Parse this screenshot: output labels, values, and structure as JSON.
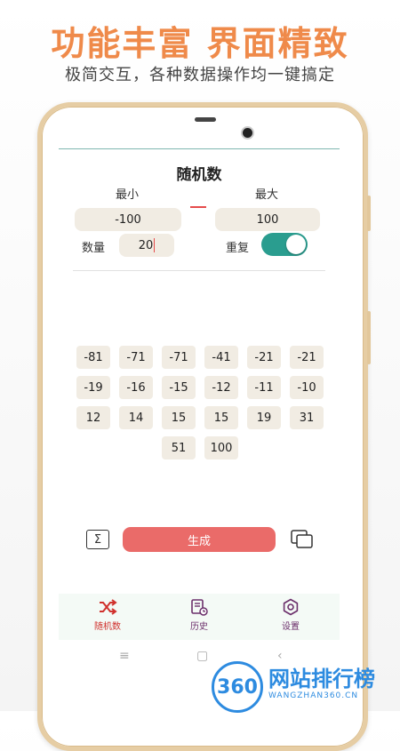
{
  "banner": {
    "headline": "功能丰富 界面精致",
    "subline": "极简交互，各种数据操作均一键搞定"
  },
  "app": {
    "title": "随机数",
    "min_label": "最小",
    "max_label": "最大",
    "min_value": "-100",
    "max_value": "100",
    "count_label": "数量",
    "count_value": "20",
    "repeat_label": "重复",
    "repeat_on": true,
    "results": [
      "-81",
      "-71",
      "-71",
      "-41",
      "-21",
      "-21",
      "-19",
      "-16",
      "-15",
      "-12",
      "-11",
      "-10",
      "12",
      "14",
      "15",
      "15",
      "19",
      "31",
      "51",
      "100"
    ],
    "sum_icon": "Σ",
    "generate_label": "生成",
    "tabs": [
      {
        "label": "随机数",
        "icon": "shuffle-icon",
        "active": true
      },
      {
        "label": "历史",
        "icon": "history-icon",
        "active": false
      },
      {
        "label": "设置",
        "icon": "settings-icon",
        "active": false
      }
    ],
    "colors": {
      "accent": "#ea6b69",
      "toggle": "#2a9d8f",
      "tab_active": "#d0312d",
      "tab_inactive": "#6b2f6b"
    }
  },
  "nav": {
    "menu": "≡",
    "home": "▢",
    "back": "‹"
  },
  "watermark": {
    "badge": "360",
    "name": "网站排行榜",
    "domain": "WANGZHAN360.CN"
  }
}
